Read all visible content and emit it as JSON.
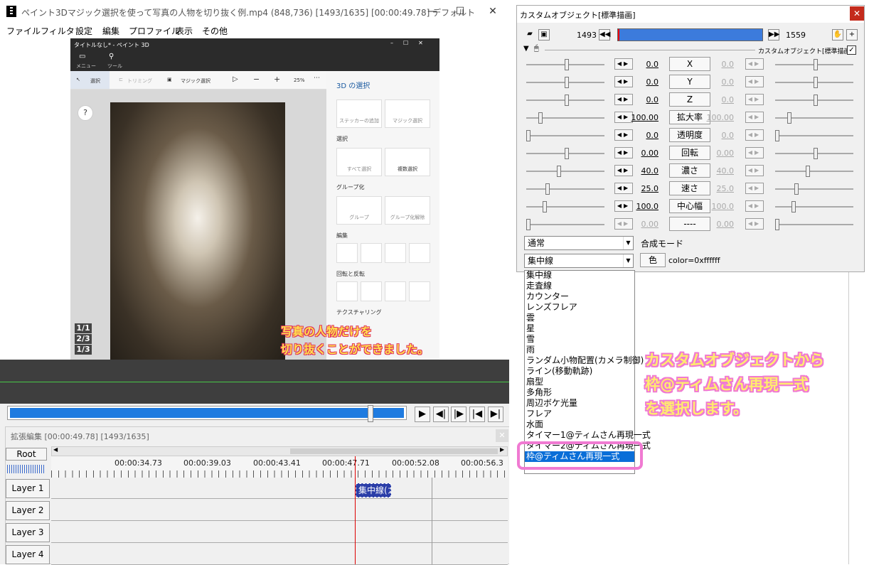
{
  "main": {
    "title": "ペイント3Dマジック選択を使って写真の人物を切り抜く例.mp4 (848,736)  [1493/1635]  [00:00:49.78]  デフォルト",
    "menu": [
      "ファイル",
      "フィルタ",
      "設定",
      "編集",
      "プロファイル",
      "表示",
      "その他"
    ]
  },
  "paint3d": {
    "title": "タイトルなし* - ペイント 3D",
    "menu_label": "メニュー",
    "tools_label": "ツール",
    "tool_select": "選択",
    "tool_crop": "トリミング",
    "tool_magic": "マジック選択",
    "zoom": "25%",
    "panel_title": "3D の選択",
    "btn_sticker": "ステッカーの追加",
    "btn_magic": "マジック選択",
    "section_select": "選択",
    "btn_select_all": "すべて選択",
    "btn_multi": "複数選択",
    "section_group": "グループ化",
    "btn_group": "グループ",
    "btn_ungroup": "グループ化解除",
    "section_edit": "編集",
    "section_rotate": "回転と反転",
    "section_texture": "テクスチャリング",
    "help": "?",
    "pages": [
      "1/1",
      "2/3",
      "1/3"
    ]
  },
  "caption": {
    "line1": "写真の人物だけを",
    "line2": "切り抜くことができました。"
  },
  "timeline": {
    "title": "拡張編集 [00:00:49.78] [1493/1635]",
    "root": "Root",
    "ticks": [
      "00:00:34.73",
      "00:00:39.03",
      "00:00:43.41",
      "00:00:47.71",
      "00:00:52.08",
      "00:00:56.3"
    ],
    "layers": [
      "Layer 1",
      "Layer 2",
      "Layer 3",
      "Layer 4"
    ],
    "clip_label": "集中線(カ"
  },
  "custom_object": {
    "title": "カスタムオブジェクト[標準描画]",
    "frame_start": "1493",
    "frame_end": "1559",
    "header_label": "カスタムオブジェクト[標準描画]",
    "params": [
      {
        "name": "X",
        "left": "0.0",
        "right": "0.0",
        "lpos": 0.52,
        "rpos": 0.52,
        "disabled": false
      },
      {
        "name": "Y",
        "left": "0.0",
        "right": "0.0",
        "lpos": 0.52,
        "rpos": 0.52,
        "disabled": false
      },
      {
        "name": "Z",
        "left": "0.0",
        "right": "0.0",
        "lpos": 0.52,
        "rpos": 0.52,
        "disabled": false
      },
      {
        "name": "拡大率",
        "left": "100.00",
        "right": "100.00",
        "lpos": 0.18,
        "rpos": 0.18,
        "disabled": false
      },
      {
        "name": "透明度",
        "left": "0.0",
        "right": "0.0",
        "lpos": 0.03,
        "rpos": 0.03,
        "disabled": false
      },
      {
        "name": "回転",
        "left": "0.00",
        "right": "0.00",
        "lpos": 0.52,
        "rpos": 0.52,
        "disabled": false
      },
      {
        "name": "濃さ",
        "left": "40.0",
        "right": "40.0",
        "lpos": 0.42,
        "rpos": 0.42,
        "disabled": false
      },
      {
        "name": "速さ",
        "left": "25.0",
        "right": "25.0",
        "lpos": 0.27,
        "rpos": 0.27,
        "disabled": false
      },
      {
        "name": "中心幅",
        "left": "100.0",
        "right": "100.0",
        "lpos": 0.24,
        "rpos": 0.24,
        "disabled": false
      },
      {
        "name": "----",
        "left": "0.00",
        "right": "0.00",
        "lpos": 0.03,
        "rpos": 0.03,
        "disabled": true
      }
    ],
    "blend_value": "通常",
    "blend_label": "合成モード",
    "type_value": "集中線",
    "color_button": "色",
    "color_text": "color=0xffffff"
  },
  "dropdown": {
    "items": [
      "集中線",
      "走査線",
      "カウンター",
      "レンズフレア",
      "雲",
      "星",
      "雪",
      "雨",
      "ランダム小物配置(カメラ制御)",
      "ライン(移動軌跡)",
      "扇型",
      "多角形",
      "周辺ボケ光量",
      "フレア",
      "水面",
      "タイマー1@ティムさん再現一式",
      "タイマー2@ティムさん再現一式"
    ],
    "selected": "枠@ティムさん再現一式"
  },
  "annotation": {
    "line1": "カスタムオブジェクトから",
    "line2": "枠@ティムさん再現一式",
    "line3": "を選択します。"
  }
}
